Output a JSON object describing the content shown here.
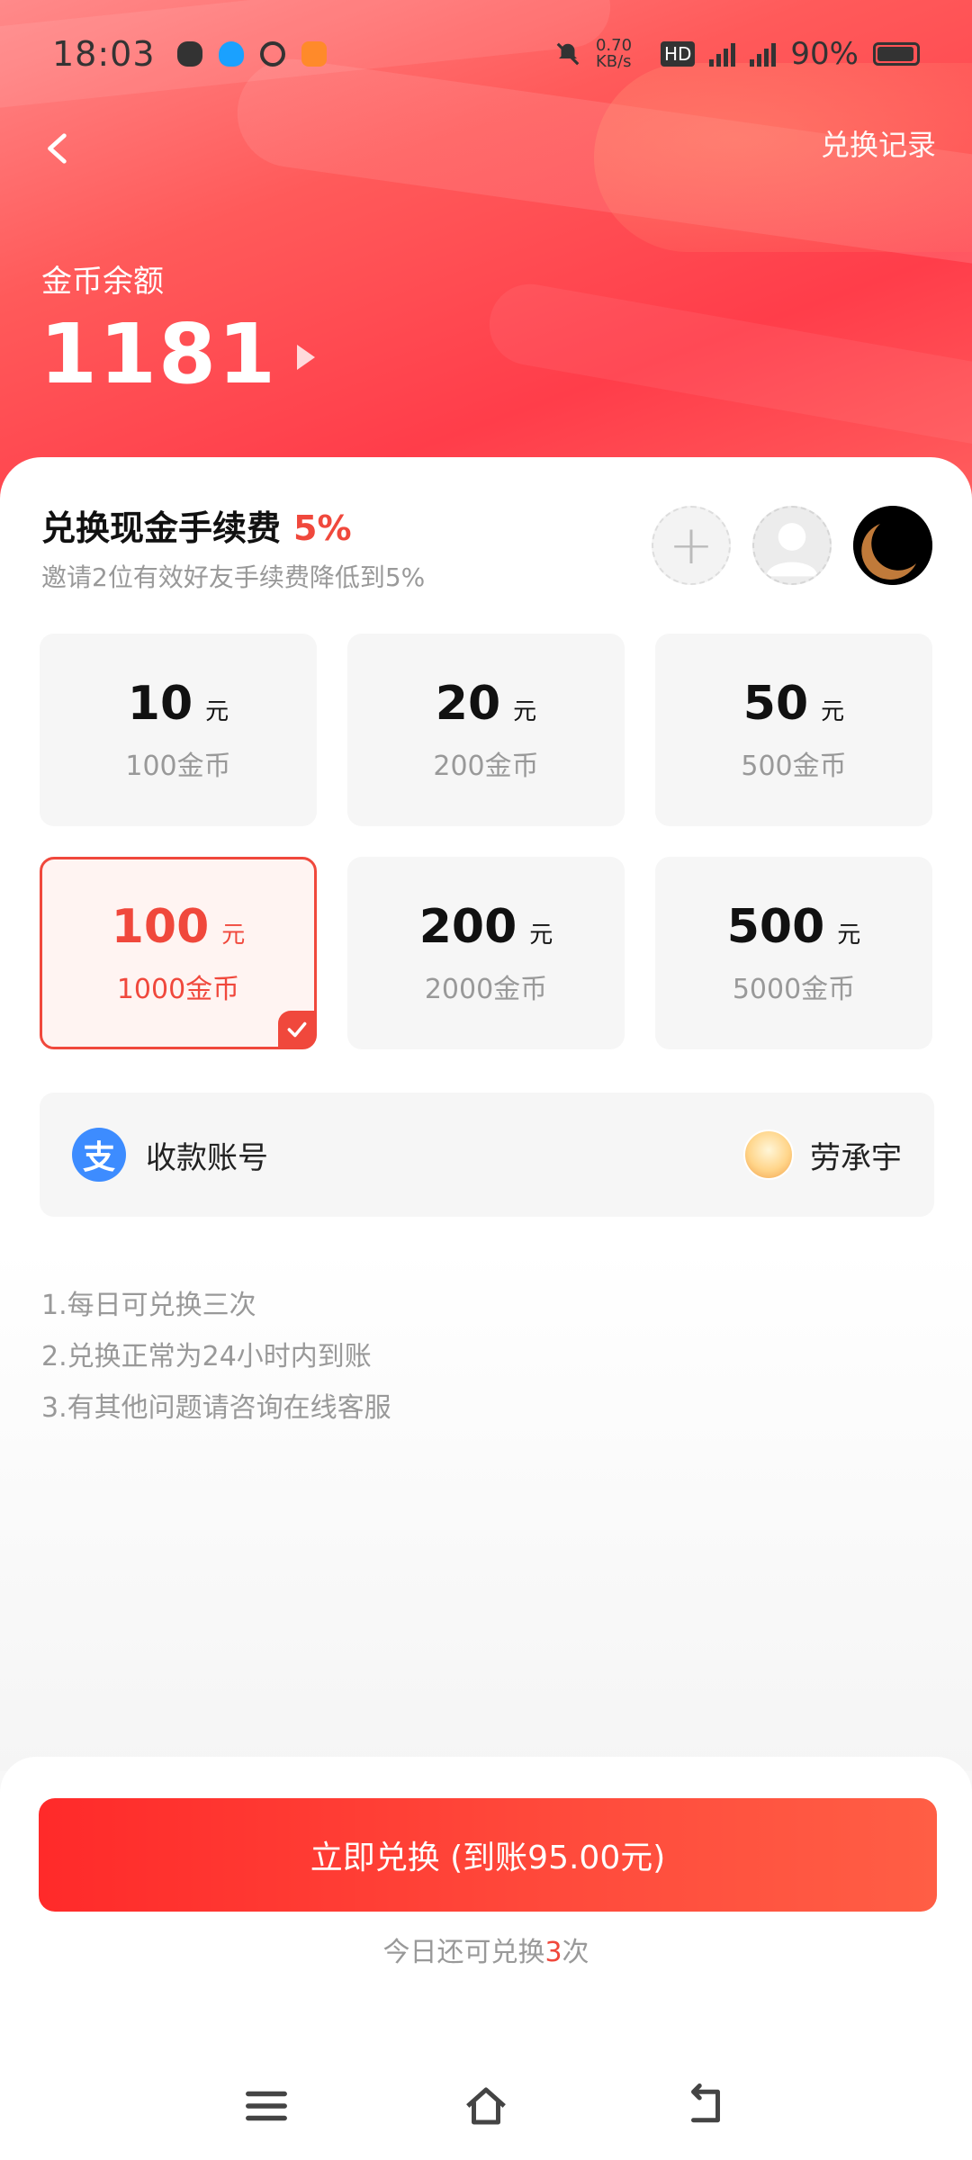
{
  "status_bar": {
    "time": "18:03",
    "network_speed": "0.70 KB/s",
    "battery": "90%",
    "icons": [
      "wechat-icon",
      "qq-icon",
      "link-icon",
      "app-icon",
      "mute-icon",
      "hd-icon",
      "signal-5g-icon",
      "signal-5g-icon",
      "battery-icon"
    ]
  },
  "header": {
    "back_icon": "chevron-left-icon",
    "record_link": "兑换记录",
    "balance_label": "金币余额",
    "balance_value": "1181"
  },
  "fee": {
    "title": "兑换现金手续费",
    "percent": "5%",
    "subtitle": "邀请2位有效好友手续费降低到5%"
  },
  "invite_avatars": [
    "add-icon",
    "default-avatar",
    "moon-avatar"
  ],
  "options": [
    {
      "amount": "10",
      "unit": "元",
      "coins": "100金币",
      "selected": false
    },
    {
      "amount": "20",
      "unit": "元",
      "coins": "200金币",
      "selected": false
    },
    {
      "amount": "50",
      "unit": "元",
      "coins": "500金币",
      "selected": false
    },
    {
      "amount": "100",
      "unit": "元",
      "coins": "1000金币",
      "selected": true
    },
    {
      "amount": "200",
      "unit": "元",
      "coins": "2000金币",
      "selected": false
    },
    {
      "amount": "500",
      "unit": "元",
      "coins": "5000金币",
      "selected": false
    }
  ],
  "account": {
    "icon_text": "支",
    "label": "收款账号",
    "name": "劳承宇"
  },
  "notes": [
    "1.每日可兑换三次",
    "2.兑换正常为24小时内到账",
    "3.有其他问题请咨询在线客服"
  ],
  "action": {
    "button_label": "立即兑换 (到账95.00元)",
    "remain_prefix": "今日还可兑换",
    "remain_count": "3",
    "remain_suffix": "次"
  },
  "colors": {
    "accent": "#f0483c",
    "header_gradient_start": "#ff8a8a",
    "header_gradient_end": "#ff3d4a",
    "alipay_blue": "#3d8cff"
  }
}
